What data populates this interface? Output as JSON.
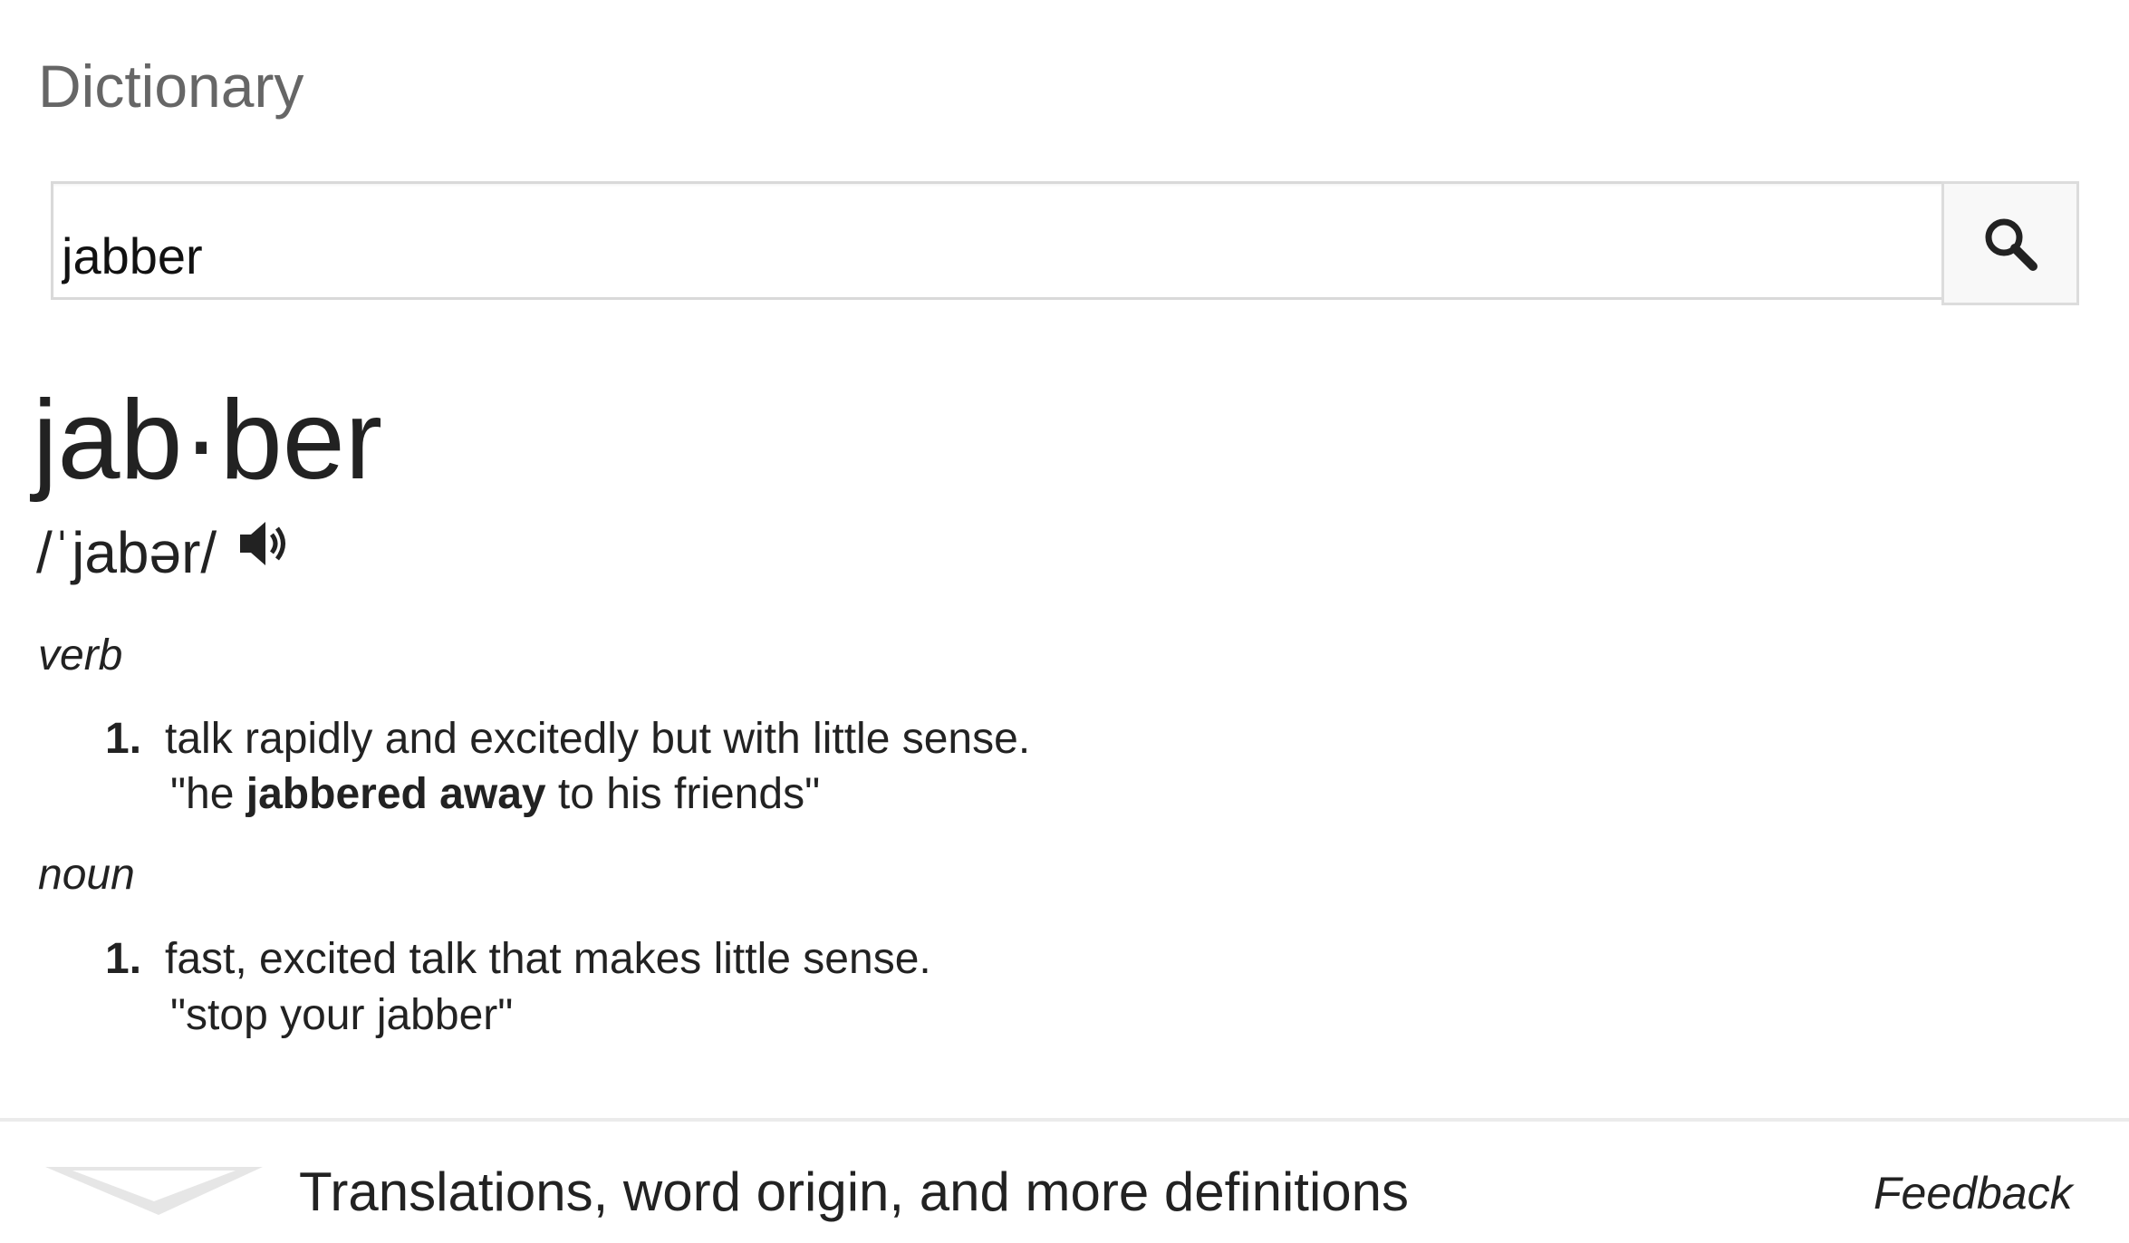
{
  "card": {
    "title": "Dictionary"
  },
  "search": {
    "value": "jabber",
    "icon": "search-icon"
  },
  "entry": {
    "headword": "jab·ber",
    "phonetic": "/ˈjabər/",
    "audio_icon": "speaker-icon",
    "senses": [
      {
        "pos": "verb",
        "definitions": [
          {
            "number": "1.",
            "text": "talk rapidly and excitedly but with little sense.",
            "example_open": "\"he ",
            "example_bold": "jabbered away",
            "example_close": " to his friends\""
          }
        ]
      },
      {
        "pos": "noun",
        "definitions": [
          {
            "number": "1.",
            "text": "fast, excited talk that makes little sense.",
            "example": "\"stop your jabber\""
          }
        ]
      }
    ]
  },
  "footer": {
    "expand_icon": "chevron-down-icon",
    "more_label": "Translations, word origin, and more definitions",
    "feedback_label": "Feedback"
  }
}
